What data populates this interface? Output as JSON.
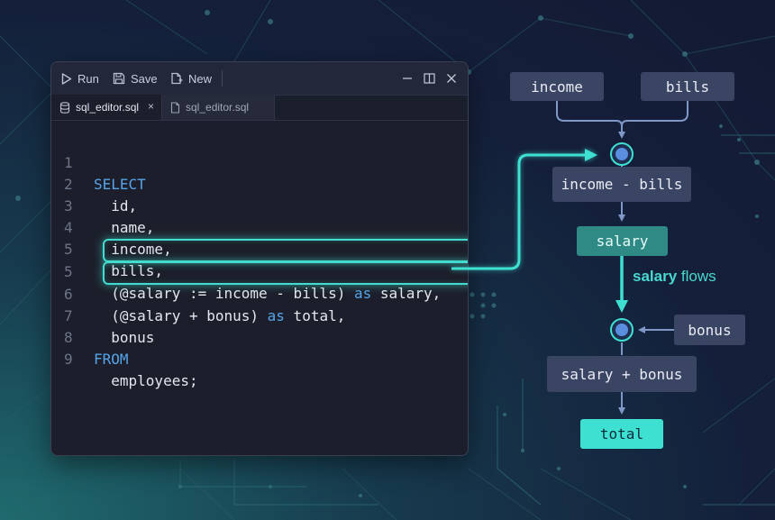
{
  "toolbar": {
    "run_label": "Run",
    "save_label": "Save",
    "new_label": "New"
  },
  "tabs": [
    {
      "label": "sql_editor.sql",
      "active": true,
      "close": "×"
    },
    {
      "label": "sql_editor.sql",
      "active": false
    }
  ],
  "code": {
    "lines": [
      {
        "num": "1",
        "text": "SELECT"
      },
      {
        "num": "2",
        "text": "  id,"
      },
      {
        "num": "3",
        "text": "  name,"
      },
      {
        "num": "4",
        "text": "  income,"
      },
      {
        "num": "5",
        "text": "  bills,"
      },
      {
        "num": "5",
        "pre": "  (@salary := income - bills) ",
        "kw": "as",
        "post": " salary,"
      },
      {
        "num": "6",
        "pre": "  (@salary + bonus) ",
        "kw": "as",
        "post": " total,"
      },
      {
        "num": "7",
        "text": "  bonus"
      },
      {
        "num": "8",
        "text": "FROM"
      },
      {
        "num": "9",
        "text": "  employees;"
      }
    ]
  },
  "diagram": {
    "income": "income",
    "bills": "bills",
    "income_minus_bills": "income - bills",
    "salary": "salary",
    "flow_label_bold": "salary",
    "flow_label_rest": " flows",
    "bonus": "bonus",
    "salary_plus_bonus": "salary + bonus",
    "total": "total"
  },
  "colors": {
    "accent": "#42dccf",
    "keyword": "#56a4e8",
    "node": "#3a4563",
    "salary_node": "#2f8a86",
    "total_node": "#3ee0d2"
  }
}
